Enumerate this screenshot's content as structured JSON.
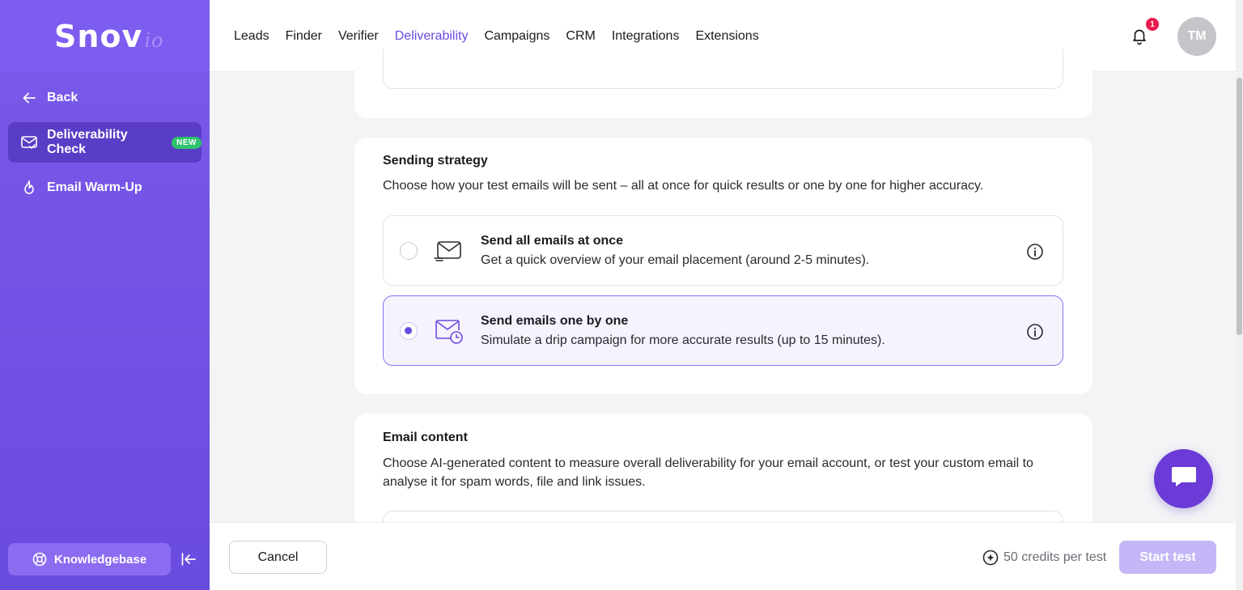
{
  "app": {
    "logo_main": "Snov",
    "logo_suffix": "io"
  },
  "sidebar": {
    "back_label": "Back",
    "items": [
      {
        "label": "Deliverability Check",
        "badge": "NEW",
        "icon": "mail-check-icon",
        "active": true
      },
      {
        "label": "Email Warm-Up",
        "icon": "flame-icon",
        "active": false
      }
    ],
    "knowledgebase_label": "Knowledgebase"
  },
  "nav": {
    "items": [
      "Leads",
      "Finder",
      "Verifier",
      "Deliverability",
      "Campaigns",
      "CRM",
      "Integrations",
      "Extensions"
    ],
    "active": "Deliverability"
  },
  "header": {
    "notification_count": "1",
    "avatar_initials": "TM"
  },
  "sending_strategy": {
    "title": "Sending strategy",
    "description": "Choose how your test emails will be sent – all at once for quick results or one by one for higher accuracy.",
    "options": [
      {
        "title": "Send all emails at once",
        "description": "Get a quick overview of your email placement (around 2-5 minutes).",
        "selected": false,
        "icon": "mail-fast-icon"
      },
      {
        "title": "Send emails one by one",
        "description": "Simulate a drip campaign for more accurate results (up to 15 minutes).",
        "selected": true,
        "icon": "mail-clock-icon"
      }
    ]
  },
  "email_content": {
    "title": "Email content",
    "description": "Choose AI-generated content to measure overall deliverability for your email account, or test your custom email to analyse it for spam words, file and link issues."
  },
  "footer": {
    "cancel_label": "Cancel",
    "credits_label": "50 credits per test",
    "start_label": "Start test"
  },
  "colors": {
    "brand": "#6a4bdf",
    "sidebar": "#7b5ae9",
    "badge_new": "#2dc26b",
    "notification": "#e81c4f",
    "start_disabled": "#c4b6f7"
  }
}
